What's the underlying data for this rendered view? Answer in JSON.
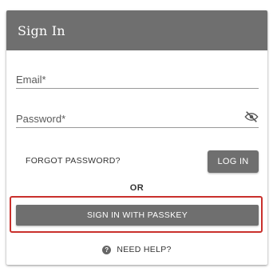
{
  "header": {
    "title": "Sign In"
  },
  "form": {
    "email": {
      "placeholder": "Email*",
      "value": ""
    },
    "password": {
      "placeholder": "Password*",
      "value": "",
      "toggle_icon": "eye-off-icon"
    },
    "forgot_label": "FORGOT PASSWORD?",
    "login_label": "LOG IN",
    "or_label": "OR",
    "passkey_label": "SIGN IN WITH PASSKEY",
    "help_label": "NEED HELP?",
    "help_icon_glyph": "?"
  },
  "colors": {
    "header_bg": "#6f6f6f",
    "button_bg": "#6f6f6f",
    "highlight_border": "#c9302c"
  }
}
